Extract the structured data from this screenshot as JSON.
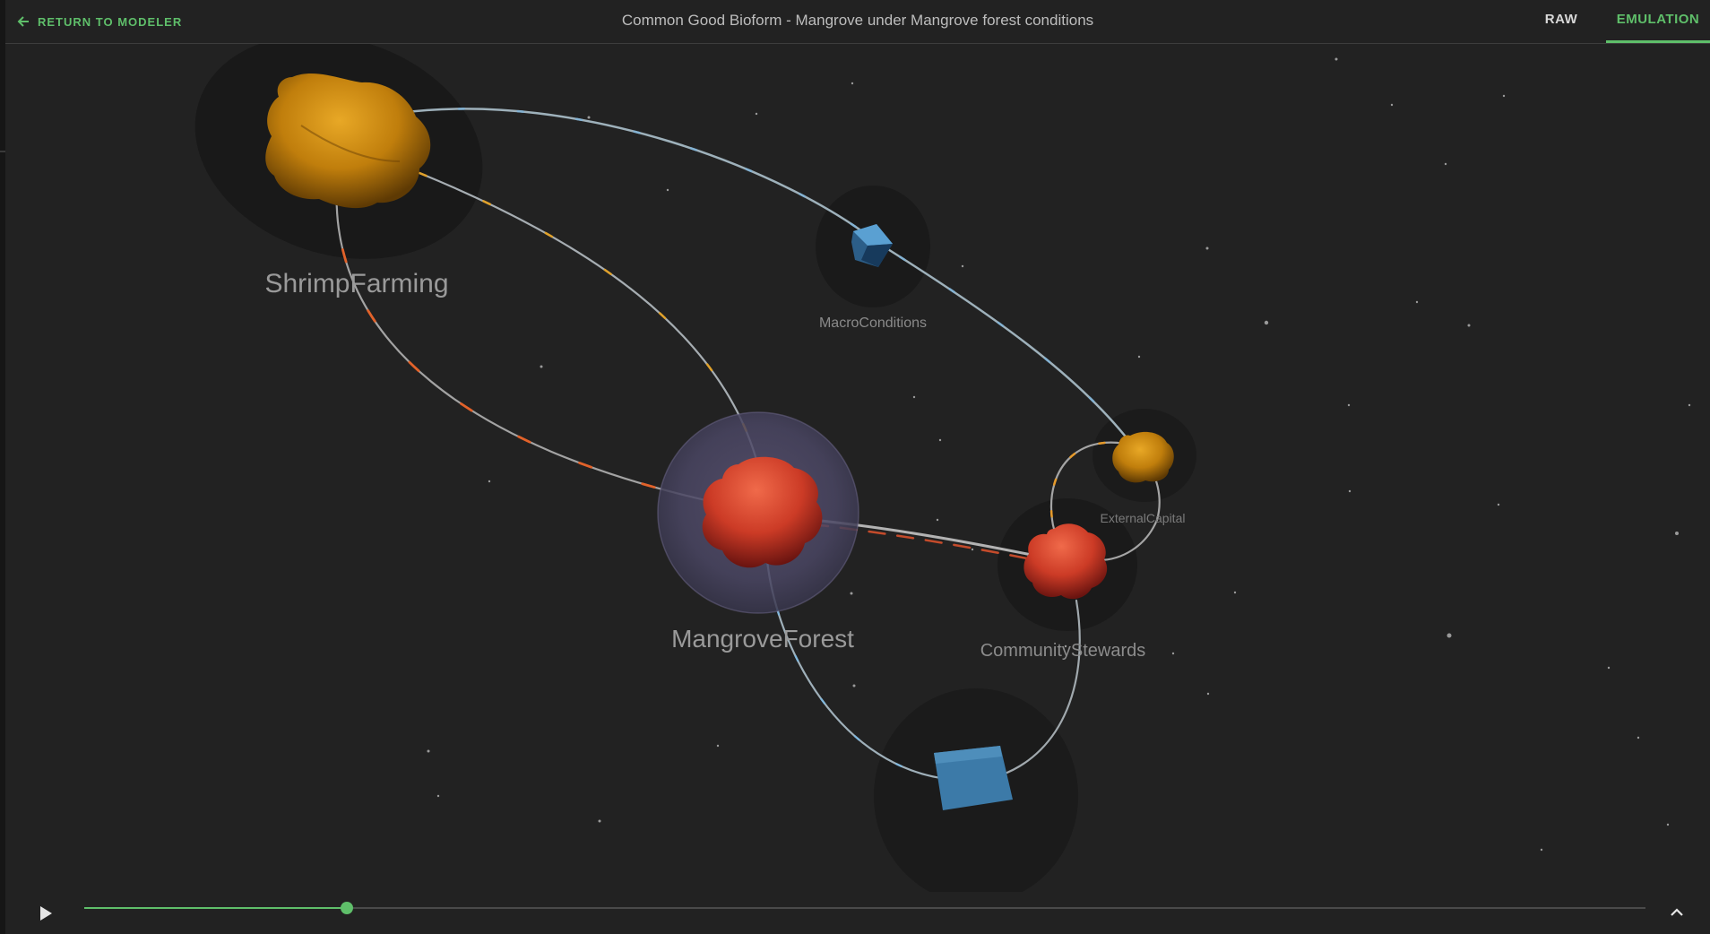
{
  "header": {
    "return_label": "RETURN TO MODELER",
    "title": "Common Good Bioform - Mangrove under Mangrove forest conditions",
    "tabs": [
      {
        "label": "RAW",
        "active": false
      },
      {
        "label": "EMULATION",
        "active": true
      }
    ]
  },
  "scene": {
    "nodes": {
      "shrimp_farming": "ShrimpFarming",
      "macro_conditions": "MacroConditions",
      "external_capital": "ExternalCapital",
      "mangrove_forest": "MangroveForest",
      "community_stewards": "CommunityStewards"
    }
  },
  "timeline": {
    "progress_fraction": 0.168,
    "play_icon": "play-icon",
    "expand_icon": "chevron-up-icon"
  },
  "colors": {
    "accent": "#5fbf6a",
    "background": "#222222",
    "amber_node": "#c8860d",
    "red_node": "#d8472e",
    "blue_node": "#3e7fb0"
  }
}
